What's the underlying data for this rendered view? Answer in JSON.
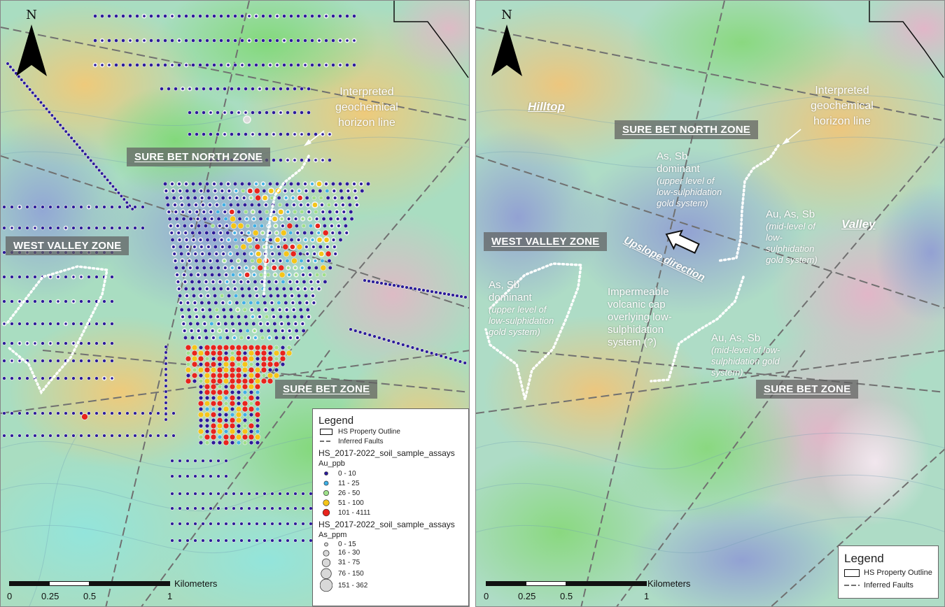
{
  "left_map": {
    "north": "N",
    "zones": {
      "north": "SURE BET NORTH ZONE",
      "west": "WEST VALLEY ZONE",
      "surebet": "SURE BET ZONE"
    },
    "annotation": {
      "line1": "Interpreted",
      "line2": "geochemical",
      "line3": "horizon line"
    },
    "scale": {
      "unit": "Kilometers",
      "ticks": [
        "0",
        "0.25",
        "0.5",
        "1"
      ]
    },
    "legend": {
      "title": "Legend",
      "outline": "HS Property Outline",
      "faults": "Inferred Faults",
      "layer1": "HS_2017-2022_soil_sample_assays",
      "field1": "Au_ppb",
      "au_classes": [
        {
          "label": "0 - 10",
          "color": "#2b1b9a"
        },
        {
          "label": "11 - 25",
          "color": "#3fb0e6"
        },
        {
          "label": "26 - 50",
          "color": "#9ee08a"
        },
        {
          "label": "51 - 100",
          "color": "#f5c518"
        },
        {
          "label": "101 - 4111",
          "color": "#e8241c"
        }
      ],
      "layer2": "HS_2017-2022_soil_sample_assays",
      "field2": "As_ppm",
      "as_classes": [
        {
          "label": "0 - 15"
        },
        {
          "label": "16 - 30"
        },
        {
          "label": "31 - 75"
        },
        {
          "label": "76 - 150"
        },
        {
          "label": "151 - 362"
        }
      ]
    }
  },
  "right_map": {
    "north": "N",
    "places": {
      "hilltop": "Hilltop",
      "valley": "Valley"
    },
    "zones": {
      "north": "SURE BET NORTH ZONE",
      "west": "WEST VALLEY ZONE",
      "surebet": "SURE BET ZONE"
    },
    "annotation": {
      "line1": "Interpreted",
      "line2": "geochemical",
      "line3": "horizon line"
    },
    "upslope": "Upslope direction",
    "notes": {
      "north_top": [
        "As, Sb",
        "dominant"
      ],
      "north_sub": [
        "(upper level of",
        "low-sulphidation",
        "gold system)"
      ],
      "east_top": [
        "Au, As, Sb"
      ],
      "east_sub": [
        "(mid-level of",
        "low-",
        "sulphidation",
        "gold system)"
      ],
      "west_top": [
        "As, Sb",
        "dominant"
      ],
      "west_sub": [
        "(upper level of",
        "low-sulphidation",
        "gold system)"
      ],
      "cap": [
        "Impermeable",
        "volcanic cap",
        "overlying low-",
        "sulphidation",
        "system (?)"
      ],
      "south_top": [
        "Au, As, Sb"
      ],
      "south_sub": [
        "(mid-level of low-",
        "sulphidation gold",
        "system)"
      ]
    },
    "scale": {
      "unit": "Kilometers",
      "ticks": [
        "0",
        "0.25",
        "0.5",
        "1"
      ]
    },
    "legend": {
      "title": "Legend",
      "outline": "HS Property Outline",
      "faults": "Inferred Faults"
    }
  }
}
